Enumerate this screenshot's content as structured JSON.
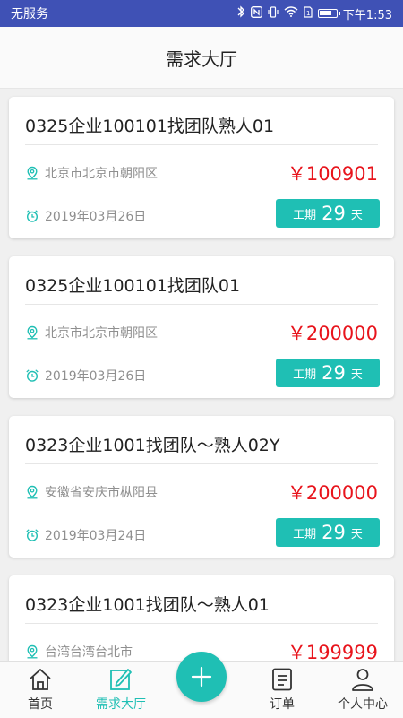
{
  "status_bar": {
    "carrier": "无服务",
    "time": "下午1:53",
    "battery_level": 0.75
  },
  "header": {
    "title": "需求大厅"
  },
  "colors": {
    "accent": "#1fbfb4",
    "price": "#e8141c",
    "status_bar": "#3f51b5"
  },
  "cards": [
    {
      "title": "0325企业100101找团队熟人01",
      "location": "北京市北京市朝阳区",
      "price": "￥100901",
      "date": "2019年03月26日",
      "period_label": "工期",
      "period_value": "29",
      "period_unit": "天"
    },
    {
      "title": "0325企业100101找团队01",
      "location": "北京市北京市朝阳区",
      "price": "￥200000",
      "date": "2019年03月26日",
      "period_label": "工期",
      "period_value": "29",
      "period_unit": "天"
    },
    {
      "title": "0323企业1001找团队～熟人02Y",
      "location": "安徽省安庆市枞阳县",
      "price": "￥200000",
      "date": "2019年03月24日",
      "period_label": "工期",
      "period_value": "29",
      "period_unit": "天"
    },
    {
      "title": "0323企业1001找团队～熟人01",
      "location": "台湾台湾台北市",
      "price": "￥199999",
      "date": "",
      "period_label": "",
      "period_value": "",
      "period_unit": ""
    }
  ],
  "tabs": {
    "home": "首页",
    "demand": "需求大厅",
    "orders": "订单",
    "profile": "个人中心"
  },
  "icons": {
    "location": "location-pin-icon",
    "date": "alarm-clock-icon",
    "add": "plus-icon"
  }
}
